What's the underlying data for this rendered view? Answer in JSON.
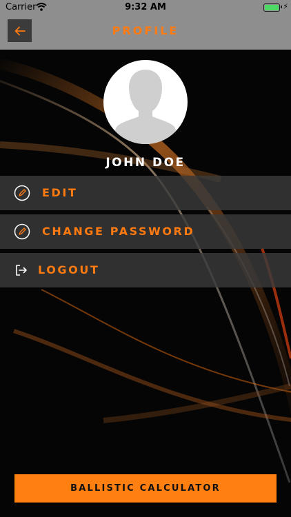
{
  "status_bar": {
    "carrier": "Carrier",
    "time": "9:32 AM",
    "battery_level": 1.0,
    "icons": [
      "wifi-icon",
      "battery-icon",
      "charging-bolt-icon"
    ]
  },
  "header": {
    "title": "PROFILE",
    "back_icon": "arrow-left-icon"
  },
  "profile": {
    "avatar_icon": "user-silhouette-icon",
    "name": "JOHN DOE"
  },
  "menu": {
    "items": [
      {
        "label": "EDIT",
        "icon": "pencil-icon"
      },
      {
        "label": "CHANGE PASSWORD",
        "icon": "pencil-icon"
      },
      {
        "label": "LOGOUT",
        "icon": "logout-icon"
      }
    ]
  },
  "footer": {
    "button_label": "BALLISTIC CALCULATOR"
  },
  "colors": {
    "accent": "#ff7a10",
    "bar": "#8e8e8e",
    "menu_bg": "#3a3a3a",
    "background": "#050505"
  }
}
